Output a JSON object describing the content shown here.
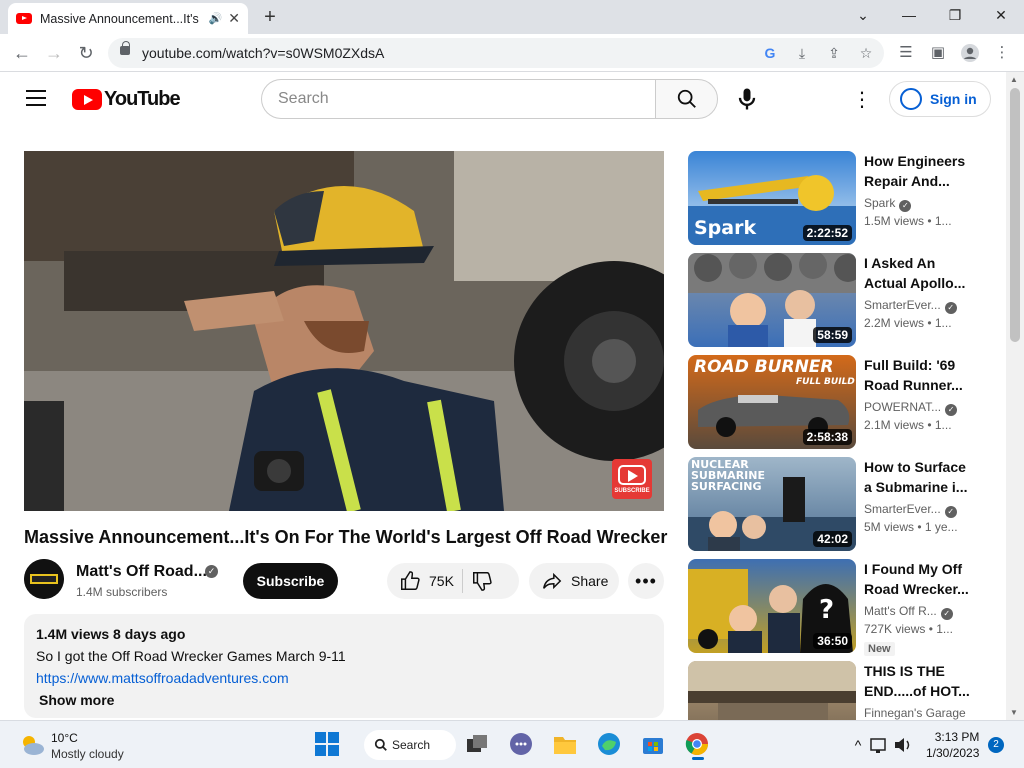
{
  "browser": {
    "tab_title": "Massive Announcement...It's",
    "tab_close": "✕",
    "new_tab": "+",
    "url": "youtube.com/watch?v=s0WSM0ZXdsA",
    "window_min": "—",
    "window_restore": "❐",
    "window_close": "✕",
    "tab_list": "⌄"
  },
  "youtube": {
    "logo_text": "YouTube",
    "search_placeholder": "Search",
    "signin_label": "Sign in"
  },
  "video": {
    "title": "Massive Announcement...It's On For The World's Largest Off Road Wrecker",
    "channel": "Matt's Off Road...",
    "subscribers": "1.4M subscribers",
    "subscribe_label": "Subscribe",
    "likes": "75K",
    "share_label": "Share",
    "views_date": "1.4M views  8 days ago",
    "description_line": "So I got the Off Road Wrecker Games March 9-11",
    "link": "https://www.mattsoffroadadventures.com",
    "show_more": "Show more",
    "watermark_text": "SUBSCRIBE"
  },
  "recommendations": [
    {
      "title": "How Engineers Repair And...",
      "channel": "Spark",
      "views": "1.5M views  • 1...",
      "duration": "2:22:52",
      "thumb_text": "Spark",
      "colors": [
        "#3a84d6",
        "#cfe4f6"
      ]
    },
    {
      "title": "I Asked An Actual Apollo...",
      "channel": "SmarterEver...",
      "views": "2.2M views  • 1...",
      "duration": "58:59",
      "colors": [
        "#8c98a6",
        "#3b6fb8"
      ]
    },
    {
      "title": "Full Build: '69 Road Runner...",
      "channel": "POWERNAT...",
      "views": "2.1M views  • 1...",
      "duration": "2:58:38",
      "thumb_text": "ROAD BURNER",
      "thumb_sub": "FULL BUILD",
      "colors": [
        "#d36a1a",
        "#5a4a3c"
      ]
    },
    {
      "title": "How to Surface a Submarine i...",
      "channel": "SmarterEver...",
      "views": "5M views  • 1 ye...",
      "duration": "42:02",
      "thumb_text": "NUCLEAR SUBMARINE SURFACING",
      "colors": [
        "#4d6f92",
        "#9fb6c9"
      ]
    },
    {
      "title": "I Found My Off Road Wrecker...",
      "channel": "Matt's Off R...",
      "views": "727K views  • 1...",
      "duration": "36:50",
      "badge": "New",
      "colors": [
        "#c2a024",
        "#3e6fb2"
      ]
    },
    {
      "title": "THIS IS THE END.....of HOT...",
      "channel": "Finnegan's Garage",
      "views": "",
      "duration": "",
      "colors": [
        "#b49a78",
        "#6c5e4c"
      ]
    }
  ],
  "taskbar": {
    "temp": "10°C",
    "weather": "Mostly cloudy",
    "search_label": "Search",
    "time": "3:13 PM",
    "date": "1/30/2023",
    "notifications": "2"
  }
}
